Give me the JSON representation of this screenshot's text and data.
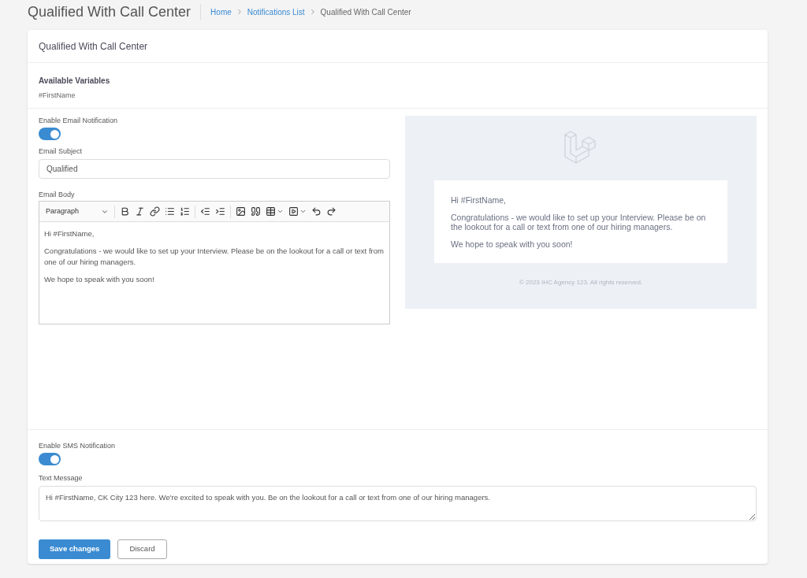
{
  "page_title": "Qualified With Call Center",
  "breadcrumb": [
    {
      "label": "Home",
      "link": true
    },
    {
      "label": "Notifications List",
      "link": true
    },
    {
      "label": "Qualified With Call Center",
      "link": false
    }
  ],
  "card_title": "Qualified With Call Center",
  "variables": {
    "label": "Available Variables",
    "items": [
      "#FirstName"
    ]
  },
  "email": {
    "toggle_label": "Enable Email Notification",
    "on": true,
    "subject_label": "Email Subject",
    "subject": "Qualified",
    "body_label": "Email Body",
    "block_format": "Paragraph",
    "body": [
      "Hi #FirstName,",
      "Congratulations - we would like to set up your Interview. Please be on the lookout for a call or text from one of our hiring managers.",
      "We hope to speak with you soon!"
    ]
  },
  "preview": {
    "body": [
      "Hi #FirstName,",
      "Congratulations - we would like to set up your Interview. Please be on the lookout for a call or text from one of our hiring managers.",
      "We hope to speak with you soon!"
    ],
    "footer": "© 2023 IHC Agency 123. All rights reserved."
  },
  "sms": {
    "toggle_label": "Enable SMS Notification",
    "on": true,
    "message_label": "Text Message",
    "message": "Hi #FirstName, CK City 123 here. We're excited to speak with you. Be on the lookout for a call or text from one of our hiring managers."
  },
  "buttons": [
    {
      "label": "Save changes",
      "kind": "primary"
    },
    {
      "label": "Discard",
      "kind": "secondary"
    }
  ]
}
